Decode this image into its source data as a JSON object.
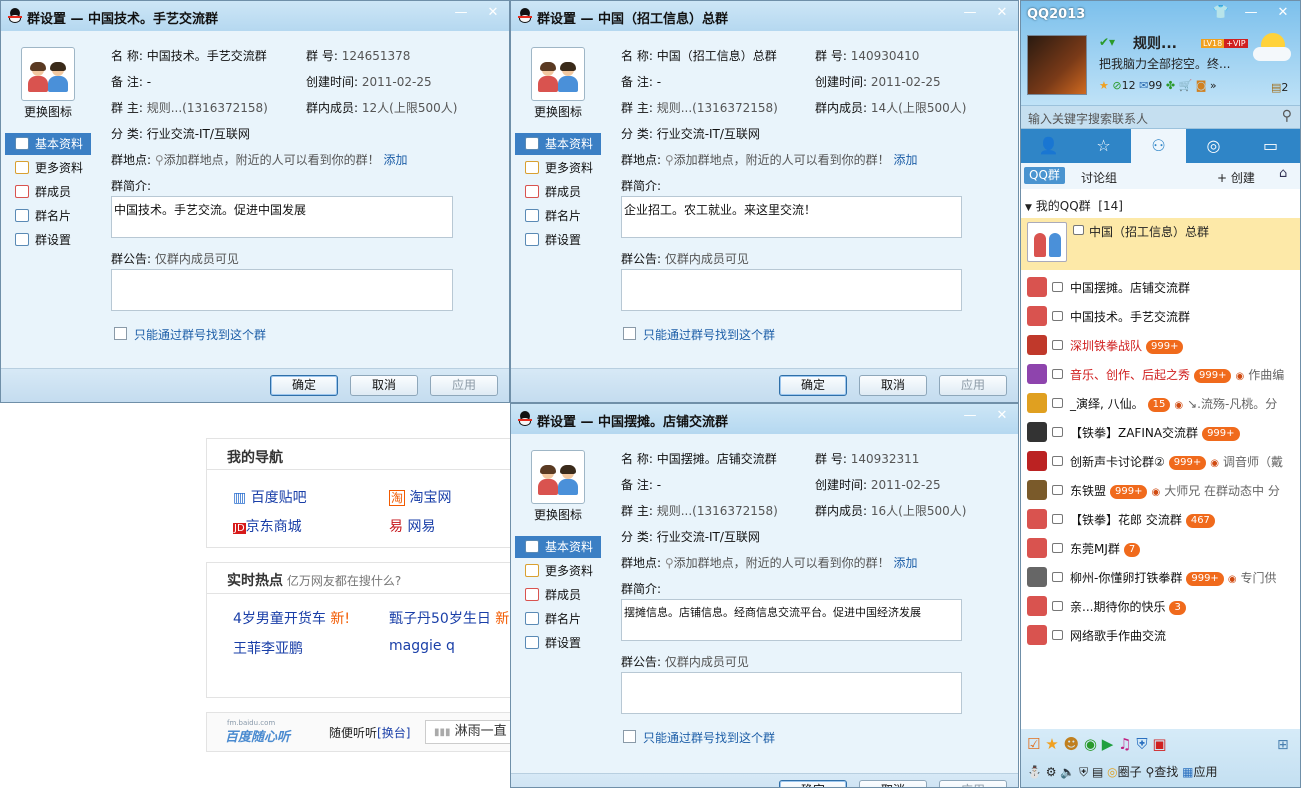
{
  "windows": [
    {
      "title": "群设置 — 中国技术。手艺交流群",
      "name_label": "名  称:",
      "name": "中国技术。手艺交流群",
      "gid_label": "群  号:",
      "gid": "124651378",
      "remark_label": "备  注:",
      "remark": "-",
      "created_label": "创建时间:",
      "created": "2011-02-25",
      "owner_label": "群  主:",
      "owner": "规则...(1316372158)",
      "members_label": "群内成员:",
      "members": "12人(上限500人)",
      "cat_label": "分  类:",
      "category": "行业交流-IT/互联网",
      "loc_label": "群地点:",
      "loc_text": "添加群地点，附近的人可以看到你的群！",
      "loc_add": "添加",
      "intro_label": "群简介:",
      "intro": "中国技术。手艺交流。促进中国发展",
      "notice_label": "群公告:",
      "notice_hint": "仅群内成员可见",
      "only_by_id": "只能通过群号找到这个群",
      "change_icon": "更换图标",
      "nav": [
        "基本资料",
        "更多资料",
        "群成员",
        "群名片",
        "群设置"
      ],
      "ok": "确定",
      "cancel": "取消",
      "apply": "应用"
    },
    {
      "title": "群设置 — 中国（招工信息）总群",
      "name_label": "名  称:",
      "name": "中国（招工信息）总群",
      "gid_label": "群  号:",
      "gid": "140930410",
      "remark_label": "备  注:",
      "remark": "-",
      "created_label": "创建时间:",
      "created": "2011-02-25",
      "owner_label": "群  主:",
      "owner": "规则...(1316372158)",
      "members_label": "群内成员:",
      "members": "14人(上限500人)",
      "cat_label": "分  类:",
      "category": "行业交流-IT/互联网",
      "loc_label": "群地点:",
      "loc_text": "添加群地点，附近的人可以看到你的群！",
      "loc_add": "添加",
      "intro_label": "群简介:",
      "intro": "企业招工。农工就业。来这里交流！",
      "notice_label": "群公告:",
      "notice_hint": "仅群内成员可见",
      "only_by_id": "只能通过群号找到这个群",
      "change_icon": "更换图标",
      "nav": [
        "基本资料",
        "更多资料",
        "群成员",
        "群名片",
        "群设置"
      ],
      "ok": "确定",
      "cancel": "取消",
      "apply": "应用"
    },
    {
      "title": "群设置 — 中国摆摊。店铺交流群",
      "name_label": "名  称:",
      "name": "中国摆摊。店铺交流群",
      "gid_label": "群  号:",
      "gid": "140932311",
      "remark_label": "备  注:",
      "remark": "-",
      "created_label": "创建时间:",
      "created": "2011-02-25",
      "owner_label": "群  主:",
      "owner": "规则...(1316372158)",
      "members_label": "群内成员:",
      "members": "16人(上限500人)",
      "cat_label": "分  类:",
      "category": "行业交流-IT/互联网",
      "loc_label": "群地点:",
      "loc_text": "添加群地点，附近的人可以看到你的群！",
      "loc_add": "添加",
      "intro_label": "群简介:",
      "intro": "摆摊信息。店铺信息。经商信息交流平台。促进中国经济发展",
      "notice_label": "群公告:",
      "notice_hint": "仅群内成员可见",
      "only_by_id": "只能通过群号找到这个群",
      "change_icon": "更换图标",
      "nav": [
        "基本资料",
        "更多资料",
        "群成员",
        "群名片",
        "群设置"
      ],
      "ok": "确定",
      "cancel": "取消",
      "apply": "应用"
    }
  ],
  "browser": {
    "nav_title": "我的导航",
    "links": [
      "百度贴吧",
      "淘宝网",
      "京东商城",
      "网易"
    ],
    "hot_title": "实时热点",
    "hot_sub": "亿万网友都在搜什么?",
    "hot_items": [
      "4岁男童开货车",
      "甄子丹50岁生日",
      "王菲李亚鹏",
      "maggie q"
    ],
    "new_tag": "新!",
    "new_tag2": "新",
    "radio_logo": "百度随心听",
    "radio_small": "fm.baidu.com",
    "radio_label": "随便听听",
    "radio_switch": "[换台]",
    "radio_song": "淋雨一直"
  },
  "qq": {
    "title": "QQ2013",
    "nickname": "规则...",
    "level": "LV18",
    "vip": "+VIP",
    "signature": "把我脑力全部挖空。终...",
    "stat1": "12",
    "stat2": "99",
    "mail_count": "2",
    "search_placeholder": "输入关键字搜索联系人",
    "subtab_group": "QQ群",
    "subtab_discuss": "讨论组",
    "create": "+ 创建",
    "my_groups": "我的QQ群",
    "group_count": "[14]",
    "selected_group": "中国（招工信息）总群",
    "groups": [
      {
        "name": "中国摆摊。店铺交流群",
        "badge": "",
        "extra": ""
      },
      {
        "name": "中国技术。手艺交流群",
        "badge": "",
        "extra": ""
      },
      {
        "name": "深圳铁拳战队",
        "badge": "999+",
        "extra": ""
      },
      {
        "name": "音乐、创作、后起之秀",
        "badge": "999+",
        "extra": "作曲编"
      },
      {
        "name": "_演绎, 八仙。",
        "badge": "15",
        "extra": "↘.流殇-凡桃。分"
      },
      {
        "name": "【铁拳】ZAFINA交流群",
        "badge": "999+",
        "extra": ""
      },
      {
        "name": "创新声卡讨论群②",
        "badge": "999+",
        "extra": "调音师（戴"
      },
      {
        "name": "东铁盟",
        "badge": "999+",
        "extra": "大师兄 在群动态中 分"
      },
      {
        "name": "【铁拳】花郎 交流群",
        "badge": "467",
        "extra": ""
      },
      {
        "name": "东莞MJ群",
        "badge": "7",
        "extra": ""
      },
      {
        "name": "柳州-你懂卵打铁拳群",
        "badge": "999+",
        "extra": "专门供"
      },
      {
        "name": "亲...期待你的快乐",
        "badge": "3",
        "extra": ""
      },
      {
        "name": "网络歌手作曲交流",
        "badge": "",
        "extra": ""
      }
    ],
    "bottom_circle": "圈子",
    "bottom_find": "查找",
    "bottom_apps": "应用"
  }
}
